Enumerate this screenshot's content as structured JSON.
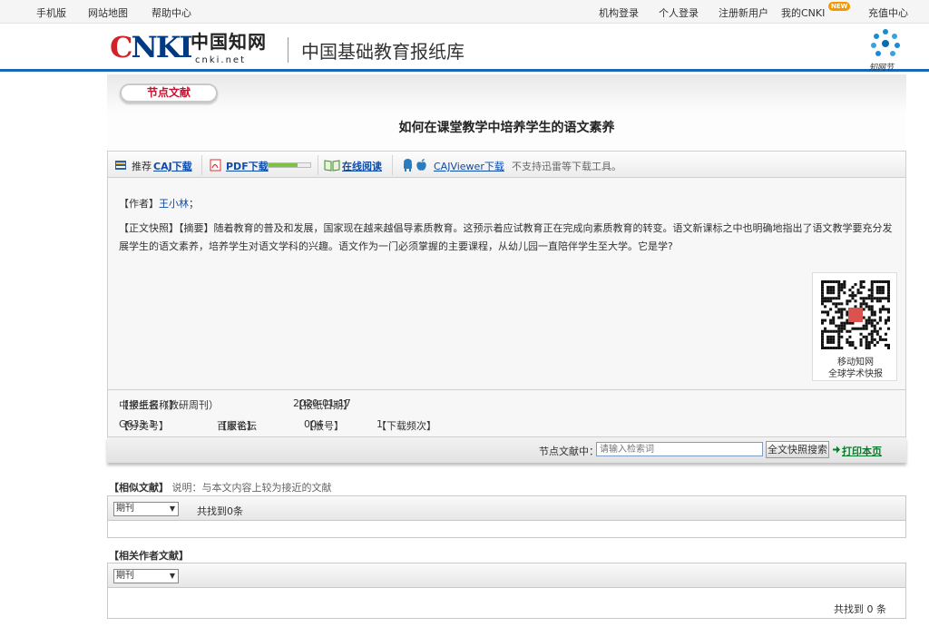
{
  "topnav": {
    "left": [
      "手机版",
      "网站地图",
      "帮助中心"
    ],
    "right": [
      "机构登录",
      "个人登录",
      "注册新用户",
      "我的CNKI",
      "充值中心"
    ],
    "new_badge": "NEW"
  },
  "header": {
    "logo_cn": "中国知网",
    "logo_net": "cnki.net",
    "logo_en": "CNKI",
    "db_title": "中国基础教育报纸库",
    "brand_label": "知网节"
  },
  "section_label": "节点文献",
  "doc_title": "如何在课堂教学中培养学生的语文素养",
  "toolbar": {
    "recommend": "推荐",
    "caj": "CAJ下载",
    "pdf": "PDF下载",
    "pdf_progress": 0.7,
    "online": "在线阅读",
    "cajviewer": "CAJViewer下载",
    "note": "不支持迅雷等下载工具。"
  },
  "author": {
    "label": "【作者】",
    "name": "王小林",
    "suffix": "；"
  },
  "abstract": {
    "label": "【正文快照】【摘要】",
    "text": "随着教育的普及和发展，国家现在越来越倡导素质教育。这预示着应试教育正在完成向素质教育的转变。语文新课标之中也明确地指出了语文教学要充分发展学生的语文素养，培养学生对语文学科的兴趣。语文作为一门必须掌握的主要课程，从幼儿园一直陪伴学生至大学。它是学?"
  },
  "qr": {
    "line1": "移动知网",
    "line2": "全球学术快报"
  },
  "meta": {
    "paper_label": "【报纸名称】",
    "paper": "中学生报（教研周刊）",
    "date_label": "【报纸日期】",
    "date": "2020-01-17",
    "class_label": "【分类号】",
    "class": "G633.3",
    "edition_label": "【版名】",
    "edition": "百家论坛",
    "page_label": "【版号】",
    "page": "004",
    "freq_label": "【下载频次】",
    "freq": "1"
  },
  "search": {
    "label": "节点文献中：",
    "placeholder": "请输入检索词",
    "button": "全文快照搜索",
    "print": "打印本页"
  },
  "similar": {
    "head": "【相似文献】",
    "note": "说明：与本文内容上较为接近的文献",
    "select": "期刊",
    "count": "共找到0条"
  },
  "related_authors": {
    "head": "【相关作者文献】",
    "select": "期刊",
    "count": "共找到 0 条"
  }
}
